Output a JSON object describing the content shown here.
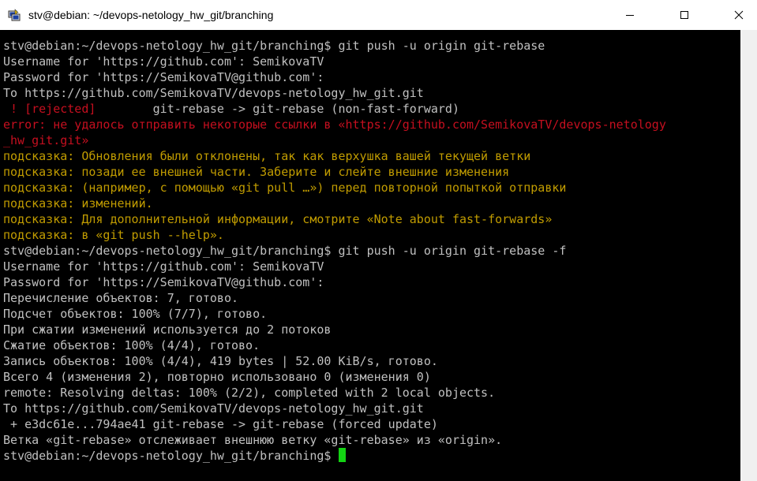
{
  "window": {
    "title": "stv@debian: ~/devops-netology_hw_git/branching",
    "app_icon": "putty-icon",
    "buttons": {
      "minimize": "minimize-icon",
      "maximize": "maximize-icon",
      "close": "close-icon"
    }
  },
  "terminal": {
    "colors": {
      "background": "#000000",
      "default": "#c0c0c0",
      "error": "#c50f1f",
      "hint": "#c19c00",
      "cursor": "#13d313"
    },
    "lines": [
      {
        "text": "stv@debian:~/devops-netology_hw_git/branching$ git push -u origin git-rebase",
        "style": ""
      },
      {
        "text": "Username for 'https://github.com': SemikovaTV",
        "style": ""
      },
      {
        "text": "Password for 'https://SemikovaTV@github.com':",
        "style": ""
      },
      {
        "text": "To https://github.com/SemikovaTV/devops-netology_hw_git.git",
        "style": ""
      },
      {
        "segments": [
          {
            "text": " ! [rejected]",
            "style": "red"
          },
          {
            "text": "        git-rebase -> git-rebase (non-fast-forward)",
            "style": ""
          }
        ]
      },
      {
        "text": "error: не удалось отправить некоторые ссылки в «https://github.com/SemikovaTV/devops-netology",
        "style": "red"
      },
      {
        "text": "_hw_git.git»",
        "style": "red"
      },
      {
        "text": "подсказка: Обновления были отклонены, так как верхушка вашей текущей ветки",
        "style": "yellow"
      },
      {
        "text": "подсказка: позади ее внешней части. Заберите и слейте внешние изменения",
        "style": "yellow"
      },
      {
        "text": "подсказка: (например, с помощью «git pull …») перед повторной попыткой отправки",
        "style": "yellow"
      },
      {
        "text": "подсказка: изменений.",
        "style": "yellow"
      },
      {
        "text": "подсказка: Для дополнительной информации, смотрите «Note about fast-forwards»",
        "style": "yellow"
      },
      {
        "text": "подсказка: в «git push --help».",
        "style": "yellow"
      },
      {
        "text": "stv@debian:~/devops-netology_hw_git/branching$ git push -u origin git-rebase -f",
        "style": ""
      },
      {
        "text": "Username for 'https://github.com': SemikovaTV",
        "style": ""
      },
      {
        "text": "Password for 'https://SemikovaTV@github.com':",
        "style": ""
      },
      {
        "text": "Перечисление объектов: 7, готово.",
        "style": ""
      },
      {
        "text": "Подсчет объектов: 100% (7/7), готово.",
        "style": ""
      },
      {
        "text": "При сжатии изменений используется до 2 потоков",
        "style": ""
      },
      {
        "text": "Сжатие объектов: 100% (4/4), готово.",
        "style": ""
      },
      {
        "text": "Запись объектов: 100% (4/4), 419 bytes | 52.00 KiB/s, готово.",
        "style": ""
      },
      {
        "text": "Всего 4 (изменения 2), повторно использовано 0 (изменения 0)",
        "style": ""
      },
      {
        "text": "remote: Resolving deltas: 100% (2/2), completed with 2 local objects.",
        "style": ""
      },
      {
        "text": "To https://github.com/SemikovaTV/devops-netology_hw_git.git",
        "style": ""
      },
      {
        "text": " + e3dc61e...794ae41 git-rebase -> git-rebase (forced update)",
        "style": ""
      },
      {
        "text": "Ветка «git-rebase» отслеживает внешнюю ветку «git-rebase» из «origin».",
        "style": ""
      },
      {
        "text": "stv@debian:~/devops-netology_hw_git/branching$ ",
        "style": "",
        "cursor": true
      }
    ]
  }
}
